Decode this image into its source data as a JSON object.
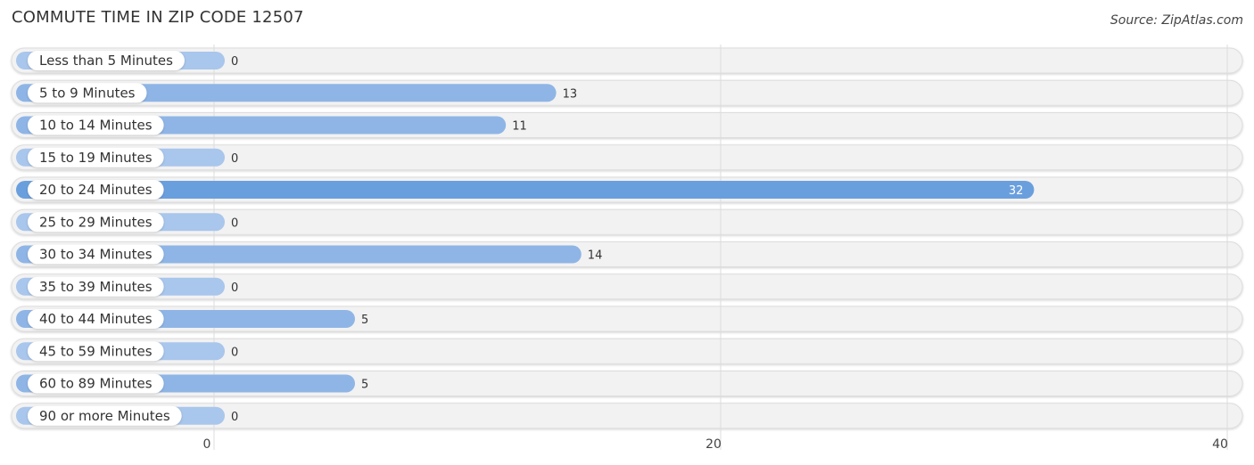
{
  "header": {
    "title": "COMMUTE TIME IN ZIP CODE 12507",
    "source": "Source: ZipAtlas.com"
  },
  "chart_data": {
    "type": "bar",
    "orientation": "horizontal",
    "title": "COMMUTE TIME IN ZIP CODE 12507",
    "source": "Source: ZipAtlas.com",
    "categories": [
      "Less than 5 Minutes",
      "5 to 9 Minutes",
      "10 to 14 Minutes",
      "15 to 19 Minutes",
      "20 to 24 Minutes",
      "25 to 29 Minutes",
      "30 to 34 Minutes",
      "35 to 39 Minutes",
      "40 to 44 Minutes",
      "45 to 59 Minutes",
      "60 to 89 Minutes",
      "90 or more Minutes"
    ],
    "values": [
      0,
      13,
      11,
      0,
      32,
      0,
      14,
      0,
      5,
      0,
      5,
      0
    ],
    "xlim": [
      0,
      40
    ],
    "xticks": [
      0,
      20,
      40
    ],
    "xtick_labels": [
      "0",
      "20",
      "40"
    ],
    "highlight_index": 4,
    "colors": {
      "bar": "#8fb5e6",
      "bar_highlight": "#6a9fde",
      "bar_zero": "#a9c6ec",
      "track": "#f2f2f2"
    },
    "grid": true,
    "legend": "none"
  }
}
